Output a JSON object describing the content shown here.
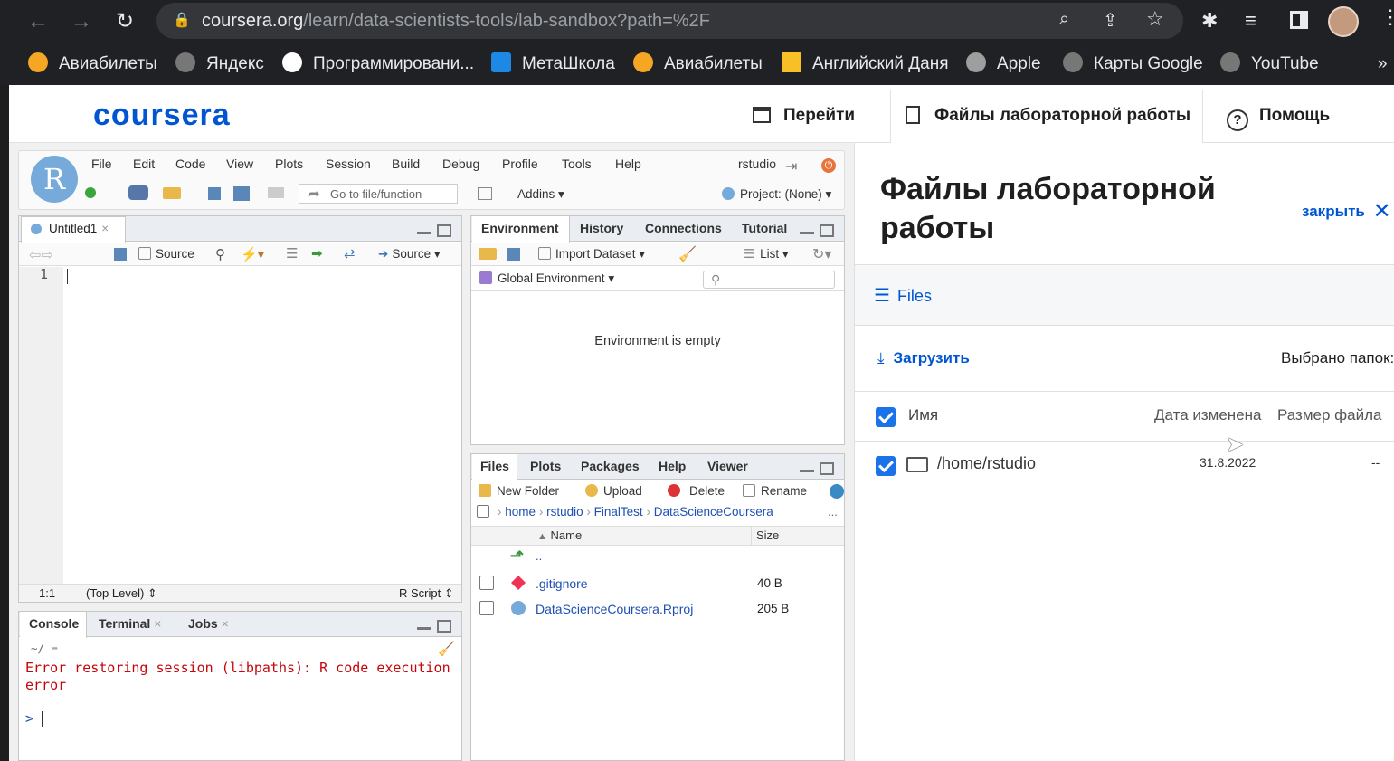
{
  "browser": {
    "url_host": "coursera.org",
    "url_path": "/learn/data-scientists-tools/lab-sandbox?path=%2F",
    "bookmarks": [
      {
        "label": "Авиабилеты",
        "color": "#f5a623"
      },
      {
        "label": "Яндекс",
        "color": "#777777"
      },
      {
        "label": "Программировани...",
        "color": "#ffffff"
      },
      {
        "label": "МетаШкола",
        "color": "#1e88e5"
      },
      {
        "label": "Авиабилеты",
        "color": "#f5a623"
      },
      {
        "label": "Английский Даня",
        "color": "#f6c026"
      },
      {
        "label": "Apple",
        "color": "#9e9e9e"
      },
      {
        "label": "Карты Google",
        "color": "#777777"
      },
      {
        "label": "YouTube",
        "color": "#777777"
      }
    ],
    "more": "»"
  },
  "coursera": {
    "logo": "coursera",
    "nav": {
      "goto": "Перейти",
      "lab_files": "Файлы лабораторной работы",
      "help": "Помощь"
    },
    "panel": {
      "title": "Файлы лабораторной работы",
      "close": "закрыть",
      "files_menu": "Files",
      "upload": "Загрузить",
      "selected_folders": "Выбрано папок:",
      "col_name": "Имя",
      "col_modified": "Дата изменена",
      "col_size": "Размер файла",
      "rows": [
        {
          "name": "/home/rstudio",
          "modified": "31.8.2022",
          "size": "--"
        }
      ]
    }
  },
  "rstudio": {
    "logo_letter": "R",
    "menu": [
      "File",
      "Edit",
      "Code",
      "View",
      "Plots",
      "Session",
      "Build",
      "Debug",
      "Profile",
      "Tools",
      "Help"
    ],
    "user": "rstudio",
    "toolbar": {
      "goto_placeholder": "Go to file/function",
      "addins": "Addins",
      "project": "Project: (None)"
    },
    "editor": {
      "tab": "Untitled1",
      "source_on_save": "Source",
      "source_btn": "Source",
      "line_number": "1",
      "status_pos": "1:1",
      "status_scope": "(Top Level)",
      "status_type": "R Script"
    },
    "console": {
      "tabs": [
        "Console",
        "Terminal",
        "Jobs"
      ],
      "path": "~/",
      "error": "Error restoring session (libpaths): R code execution error",
      "prompt": ">"
    },
    "environment": {
      "tabs": [
        "Environment",
        "History",
        "Connections",
        "Tutorial"
      ],
      "import": "Import Dataset",
      "view": "List",
      "scope": "Global Environment",
      "empty": "Environment is empty"
    },
    "files": {
      "tabs": [
        "Files",
        "Plots",
        "Packages",
        "Help",
        "Viewer"
      ],
      "actions": {
        "new_folder": "New Folder",
        "upload": "Upload",
        "delete": "Delete",
        "rename": "Rename"
      },
      "breadcrumb": [
        "home",
        "rstudio",
        "FinalTest",
        "DataScienceCoursera"
      ],
      "more": "...",
      "col_name": "Name",
      "col_size": "Size",
      "parent": "..",
      "rows": [
        {
          "name": ".gitignore",
          "size": "40 B"
        },
        {
          "name": "DataScienceCoursera.Rproj",
          "size": "205 B"
        }
      ]
    }
  }
}
